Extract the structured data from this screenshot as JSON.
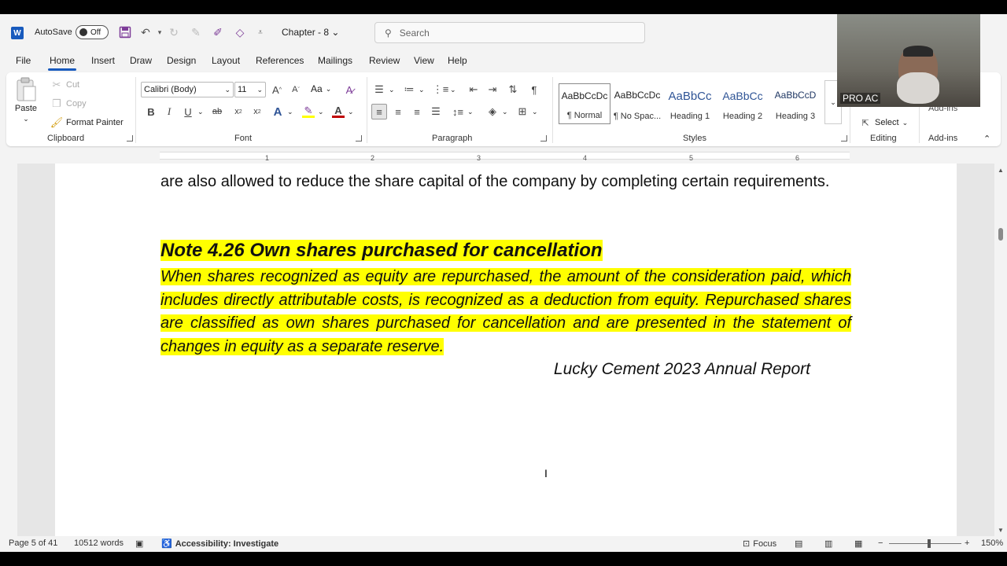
{
  "titlebar": {
    "app_icon": "word-icon",
    "autosave_label": "AutoSave",
    "autosave_state": "Off",
    "doc_title": "Chapter - 8",
    "search_placeholder": "Search"
  },
  "tabs": [
    "File",
    "Home",
    "Insert",
    "Draw",
    "Design",
    "Layout",
    "References",
    "Mailings",
    "Review",
    "View",
    "Help"
  ],
  "active_tab": "Home",
  "ribbon": {
    "clipboard": {
      "paste": "Paste",
      "cut": "Cut",
      "copy": "Copy",
      "format_painter": "Format Painter",
      "label": "Clipboard"
    },
    "font": {
      "family": "Calibri (Body)",
      "size": "11",
      "label": "Font",
      "case": "Aa"
    },
    "paragraph": {
      "label": "Paragraph"
    },
    "styles": {
      "label": "Styles",
      "items": [
        {
          "sample": "AaBbCcDc",
          "name": "¶ Normal"
        },
        {
          "sample": "AaBbCcDc",
          "name": "¶ No Spac..."
        },
        {
          "sample": "AaBbCc",
          "name": "Heading 1"
        },
        {
          "sample": "AaBbCc",
          "name": "Heading 2"
        },
        {
          "sample": "AaBbCcD",
          "name": "Heading 3"
        }
      ]
    },
    "editing": {
      "select": "Select",
      "label": "Editing"
    },
    "addins": {
      "button": "Add-ins",
      "label": "Add-ins"
    }
  },
  "video": {
    "name": "PRO AC"
  },
  "ruler": [
    "1",
    "2",
    "3",
    "4",
    "5",
    "6"
  ],
  "document": {
    "para1": "are also allowed to reduce the share capital of the company by completing certain requirements.",
    "heading": "Note 4.26 Own shares purchased for cancellation",
    "body": "When shares recognized as equity are repurchased, the amount of the consideration paid, which includes directly attributable costs, is recognized as a deduction from equity. Repurchased shares are classified as own shares purchased for cancellation and are presented in the statement of changes in equity as a separate reserve.",
    "source": "Lucky Cement 2023 Annual Report"
  },
  "status": {
    "page": "Page 5 of 41",
    "words": "10512 words",
    "accessibility": "Accessibility: Investigate",
    "focus": "Focus",
    "zoom": "150%"
  },
  "colors": {
    "accent": "#185abd",
    "highlight": "#ffff00"
  }
}
